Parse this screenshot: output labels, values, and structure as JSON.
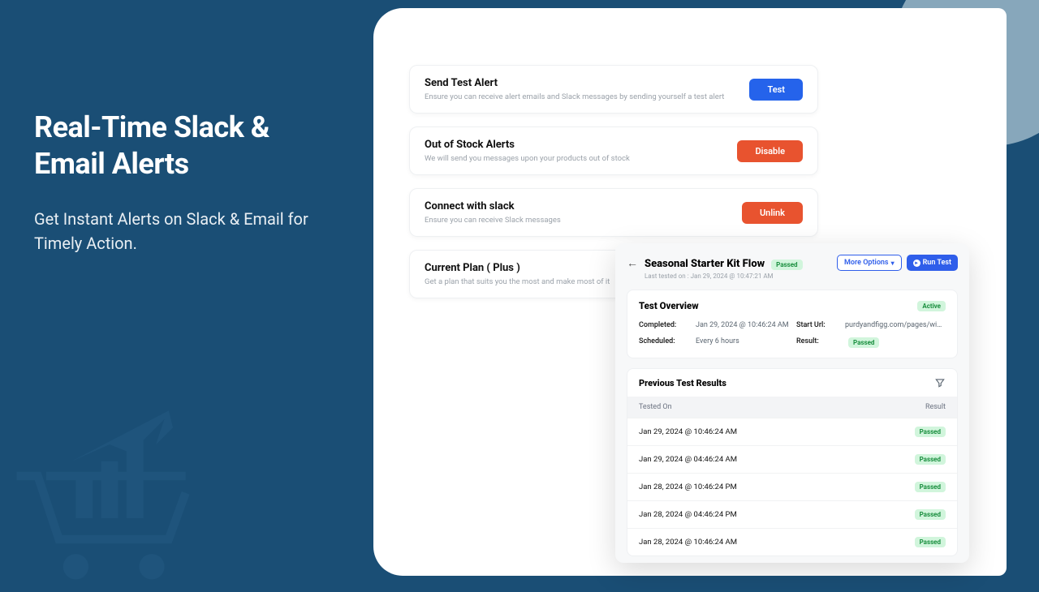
{
  "hero": {
    "title": "Real-Time Slack & Email Alerts",
    "subtitle": "Get Instant Alerts on Slack & Email for Timely Action."
  },
  "settings": [
    {
      "title": "Send Test Alert",
      "desc": "Ensure you can receive alert emails and Slack messages by sending yourself a test alert",
      "action": "Test",
      "variant": "blue"
    },
    {
      "title": "Out of Stock Alerts",
      "desc": "We will send you messages upon your products out of stock",
      "action": "Disable",
      "variant": "orange"
    },
    {
      "title": "Connect with slack",
      "desc": "Ensure you can receive Slack messages",
      "action": "Unlink",
      "variant": "orange"
    },
    {
      "title": "Current Plan ( Plus )",
      "desc": "Get a plan that suits you the most and make most of it",
      "action": "",
      "variant": "none"
    }
  ],
  "flow": {
    "title": "Seasonal Starter Kit Flow",
    "status": "Passed",
    "last_tested": "Last tested on : Jan 29, 2024 @ 10:47:21 AM",
    "more_options": "More Options",
    "run_test": "Run Test",
    "overview": {
      "heading": "Test Overview",
      "active": "Active",
      "completed_label": "Completed:",
      "completed": "Jan 29, 2024 @ 10:46:24 AM",
      "starturl_label": "Start Url:",
      "starturl": "purdyandfigg.com/pages/winter-...",
      "scheduled_label": "Scheduled:",
      "scheduled": "Every 6 hours",
      "result_label": "Result:",
      "result": "Passed"
    },
    "results": {
      "heading": "Previous Test Results",
      "col_tested": "Tested On",
      "col_result": "Result",
      "rows": [
        {
          "when": "Jan 29, 2024 @ 10:46:24 AM",
          "result": "Passed"
        },
        {
          "when": "Jan 29, 2024 @ 04:46:24 AM",
          "result": "Passed"
        },
        {
          "when": "Jan 28, 2024 @ 10:46:24 PM",
          "result": "Passed"
        },
        {
          "when": "Jan 28, 2024 @ 04:46:24 PM",
          "result": "Passed"
        },
        {
          "when": "Jan 28, 2024 @ 10:46:24 AM",
          "result": "Passed"
        }
      ]
    }
  }
}
